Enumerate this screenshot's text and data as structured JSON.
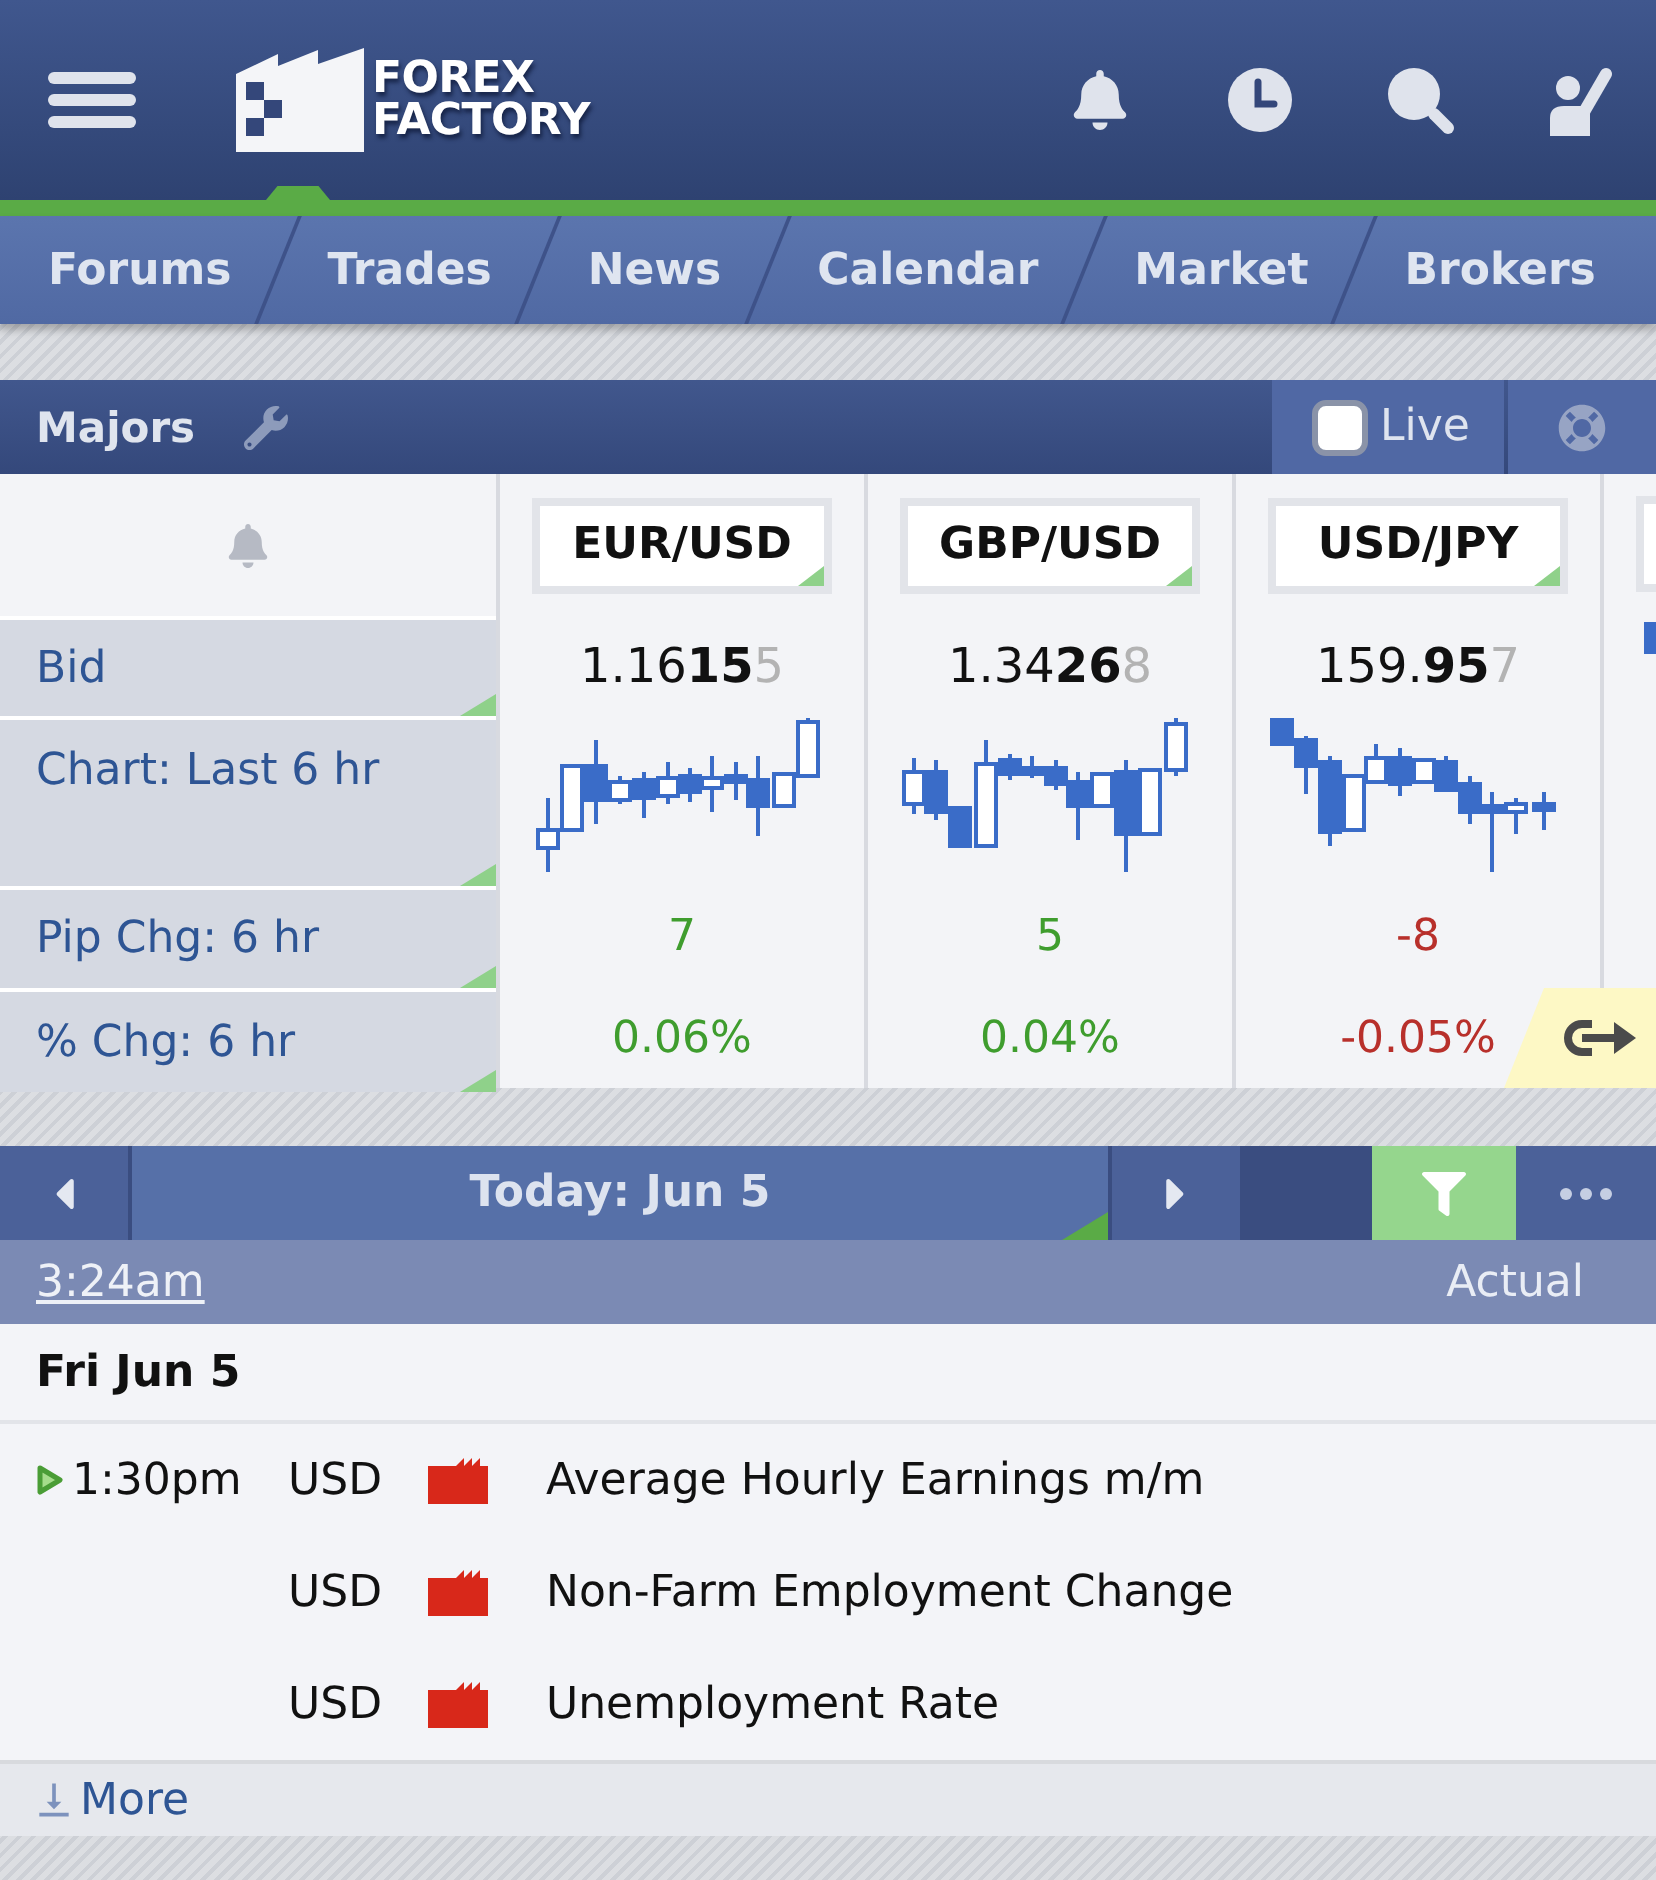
{
  "header": {
    "logo": {
      "lines": [
        "FOREX",
        "FACTORY"
      ]
    }
  },
  "nav_tabs": [
    {
      "label": "Forums"
    },
    {
      "label": "Trades"
    },
    {
      "label": "News"
    },
    {
      "label": "Calendar"
    },
    {
      "label": "Market"
    },
    {
      "label": "Brokers"
    }
  ],
  "majors": {
    "title": "Majors",
    "live": {
      "label": "Live",
      "checked": false
    },
    "row_labels": [
      "Bid",
      "Chart: Last 6 hr",
      "Pip Chg: 6 hr",
      "% Chg: 6 hr"
    ],
    "pairs": [
      {
        "symbol": "EUR/USD",
        "bid": {
          "big_figure": "1.16",
          "pips": "15",
          "pipette": "5"
        },
        "pip_change": "7",
        "percent_change": "0.06%",
        "negative": false
      },
      {
        "symbol": "GBP/USD",
        "bid": {
          "big_figure": "1.34",
          "pips": "26",
          "pipette": "8"
        },
        "pip_change": "5",
        "percent_change": "0.04%",
        "negative": false
      },
      {
        "symbol": "USD/JPY",
        "bid": {
          "big_figure": "159.",
          "pips": "95",
          "pipette": "7"
        },
        "pip_change": "-8",
        "percent_change": "-0.05%",
        "negative": true
      }
    ]
  },
  "calendar": {
    "date_label": "Today: Jun 5",
    "filter_active": true,
    "current_time": "3:24am",
    "column_label": "Actual",
    "day": "Fri Jun 5",
    "events": [
      {
        "time": "1:30pm",
        "upcoming": true,
        "currency": "USD",
        "color": "#d8281a",
        "title": "Average Hourly Earnings m/m"
      },
      {
        "upcoming": false,
        "currency": "USD",
        "color": "#d8281a",
        "title": "Non-Farm Employment Change"
      },
      {
        "upcoming": false,
        "currency": "USD",
        "color": "#d8281a",
        "title": "Unemployment Rate"
      }
    ],
    "more_label": "More"
  }
}
